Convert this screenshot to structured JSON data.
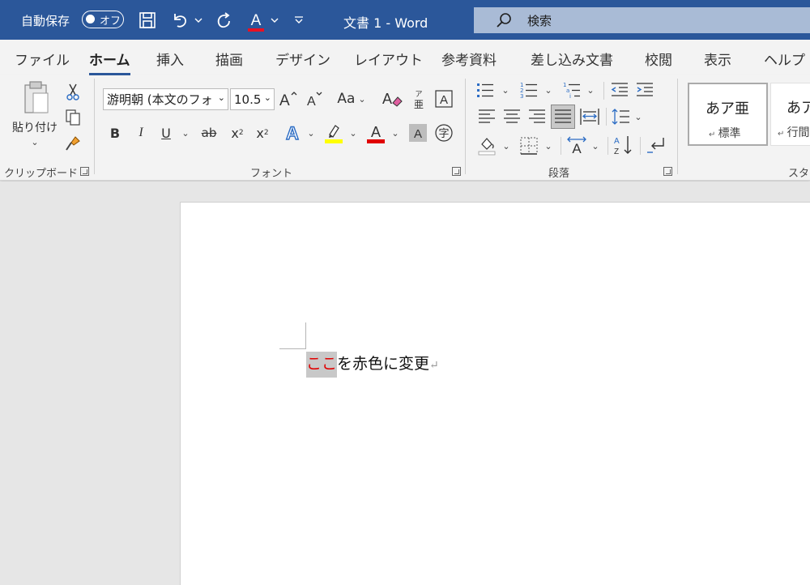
{
  "titlebar": {
    "autosave_label": "自動保存",
    "autosave_toggle": "オフ",
    "doc_title": "文書 1  -  Word",
    "search_placeholder": "検索"
  },
  "menu": {
    "tabs": [
      "ファイル",
      "ホーム",
      "挿入",
      "描画",
      "デザイン",
      "レイアウト",
      "参考資料",
      "差し込み文書",
      "校閲",
      "表示",
      "ヘルプ"
    ],
    "active": "ホーム"
  },
  "ribbon": {
    "clipboard": {
      "paste_label": "貼り付け",
      "group_label": "クリップボード"
    },
    "font": {
      "font_name": "游明朝 (本文のフォ",
      "font_size": "10.5",
      "change_case": "Aa",
      "bold": "B",
      "italic": "I",
      "underline": "U",
      "strikethrough": "ab",
      "subscript": "x",
      "subscript_mark": "2",
      "superscript": "x",
      "superscript_mark": "2",
      "group_label": "フォント",
      "highlight_color": "#ffff00",
      "font_color": "#e00000"
    },
    "paragraph": {
      "group_label": "段落"
    },
    "styles": {
      "items": [
        {
          "sample": "あア亜",
          "name": "標準"
        },
        {
          "sample": "あア",
          "name": "行間"
        }
      ],
      "group_label": "スタ"
    }
  },
  "document": {
    "selected_text": "ここ",
    "rest_text": "を赤色に変更",
    "para_mark": "↵"
  },
  "colors": {
    "title_bar": "#2b579a",
    "accent": "#2b579a",
    "ribbon_bg": "#f3f3f3",
    "canvas_bg": "#e6e6e6",
    "red_text": "#e00000"
  }
}
